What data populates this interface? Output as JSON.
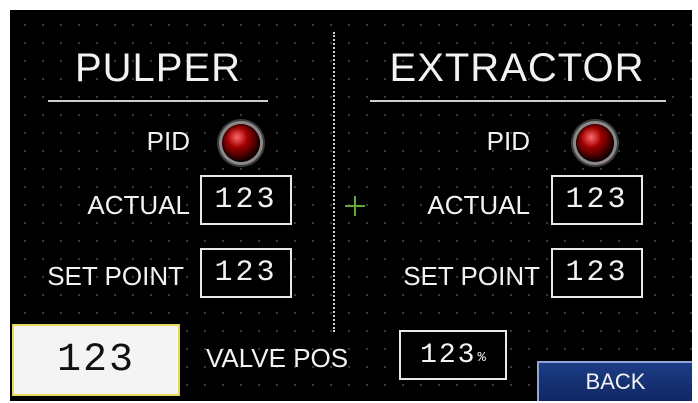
{
  "left_panel": {
    "title": "PULPER",
    "pid_label": "PID",
    "actual_label": "ACTUAL",
    "actual_value": "123",
    "setpoint_label": "SET POINT",
    "setpoint_value": "123"
  },
  "right_panel": {
    "title": "EXTRACTOR",
    "pid_label": "PID",
    "actual_label": "ACTUAL",
    "actual_value": "123",
    "setpoint_label": "SET POINT",
    "setpoint_value": "123"
  },
  "footer": {
    "main_display_value": "123",
    "valve_label": "VALVE POS",
    "valve_value": "123",
    "valve_unit": "%",
    "back_label": "BACK"
  },
  "icons": {
    "pid_indicator": "red-led-indicator-icon",
    "crosshair": "crosshair-icon"
  },
  "colors": {
    "background": "#000000",
    "text": "#f2f2f2",
    "led": "#a10000",
    "back_button": "#1d3d86",
    "display_border": "#e6d85a"
  }
}
